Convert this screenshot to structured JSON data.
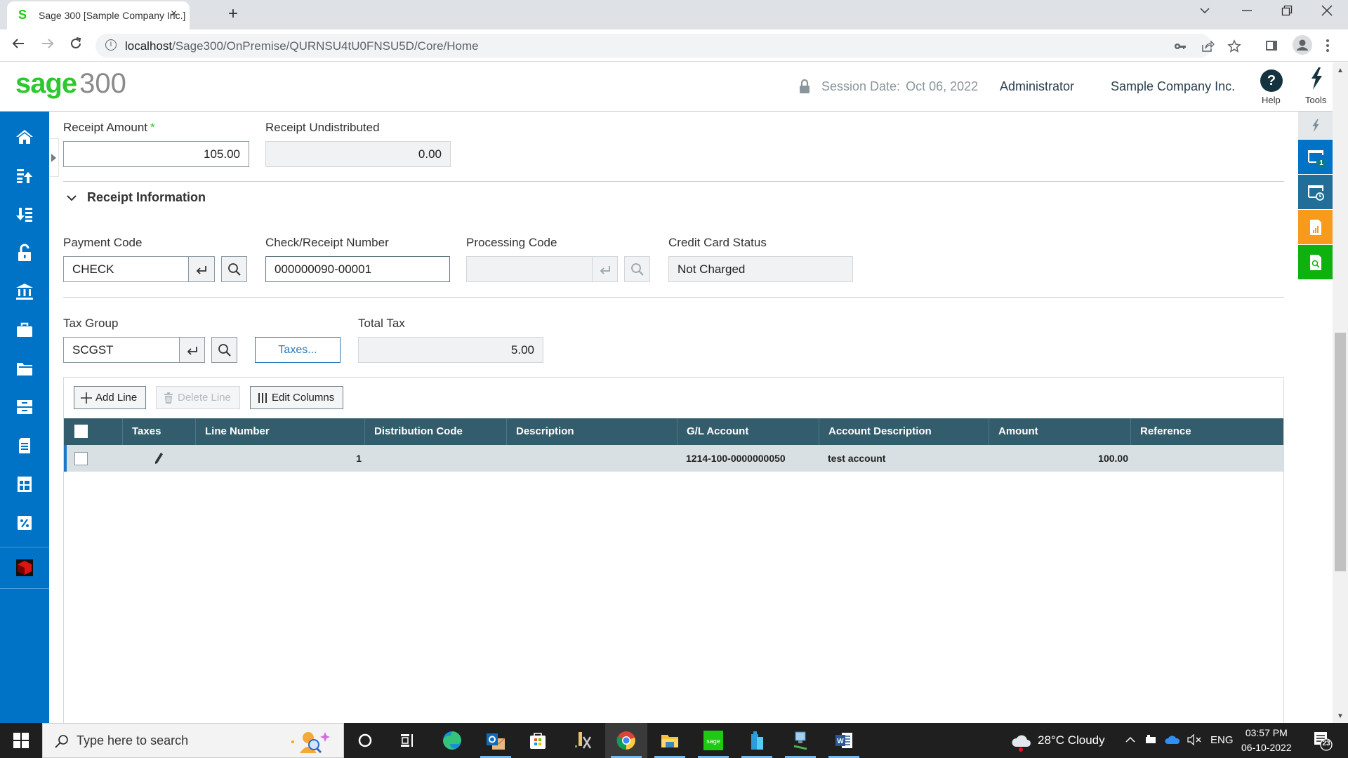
{
  "browser": {
    "tab_title": "Sage 300 [Sample Company Inc.]",
    "tab_favicon": "S",
    "close_tab_icon": "×",
    "new_tab_icon": "+",
    "url_host": "localhost",
    "url_path": "/Sage300/OnPremise/QURNSU4tU0FNSU5D/Core/Home"
  },
  "header": {
    "logo_brand": "sage",
    "logo_product": "300",
    "session_label": "Session Date:",
    "session_date": "Oct 06, 2022",
    "user": "Administrator",
    "company": "Sample Company Inc.",
    "help_label": "Help",
    "tools_label": "Tools"
  },
  "sidebar": {
    "items": [
      {
        "icon": "home-icon"
      },
      {
        "icon": "receivables-icon"
      },
      {
        "icon": "payables-icon"
      },
      {
        "icon": "security-icon"
      },
      {
        "icon": "bank-icon"
      },
      {
        "icon": "briefcase-icon"
      },
      {
        "icon": "folder-icon"
      },
      {
        "icon": "inventory-icon"
      },
      {
        "icon": "document-icon"
      },
      {
        "icon": "table-icon"
      },
      {
        "icon": "tax-icon"
      },
      {
        "icon": "custom-module-icon"
      }
    ]
  },
  "right_panel": {
    "items": [
      {
        "icon": "quick-tools-icon",
        "color": "#e4e8ea"
      },
      {
        "icon": "windows-icon",
        "color": "#0073c6",
        "badge": "1"
      },
      {
        "icon": "recent-windows-icon",
        "color": "#216e99"
      },
      {
        "icon": "report-icon",
        "color": "#f89a1c"
      },
      {
        "icon": "inquiry-icon",
        "color": "#0eb10e"
      }
    ]
  },
  "form": {
    "receipt_amount": {
      "label": "Receipt Amount",
      "required_mark": "*",
      "value": "105.00"
    },
    "receipt_undistributed": {
      "label": "Receipt Undistributed",
      "value": "0.00"
    },
    "section_title": "Receipt Information",
    "payment_code": {
      "label": "Payment Code",
      "value": "CHECK"
    },
    "check_receipt_number": {
      "label": "Check/Receipt Number",
      "value": "000000090-00001"
    },
    "processing_code": {
      "label": "Processing Code",
      "value": ""
    },
    "credit_card_status": {
      "label": "Credit Card Status",
      "value": "Not Charged"
    },
    "tax_group": {
      "label": "Tax Group",
      "value": "SCGST"
    },
    "taxes_button": "Taxes...",
    "total_tax": {
      "label": "Total Tax",
      "value": "5.00"
    }
  },
  "grid": {
    "toolbar": {
      "add_line": "Add Line",
      "delete_line": "Delete Line",
      "edit_columns": "Edit Columns"
    },
    "columns": [
      "Taxes",
      "Line Number",
      "Distribution Code",
      "Description",
      "G/L Account",
      "Account Description",
      "Amount",
      "Reference"
    ],
    "rows": [
      {
        "taxes": "edit-icon",
        "line_number": "1",
        "distribution_code": "",
        "description": "",
        "gl_account": "1214-100-0000000050",
        "account_description": "test account",
        "amount": "100.00",
        "reference": ""
      }
    ]
  },
  "taskbar": {
    "search_placeholder": "Type here to search",
    "weather": "28°C  Cloudy",
    "language": "ENG",
    "time": "03:57 PM",
    "date": "06-10-2022",
    "notification_count": "23"
  },
  "colors": {
    "sidebar": "#0073c6",
    "grid_header": "#335d6d",
    "brand_green": "#2dc82d",
    "link_blue": "#2a79b8"
  }
}
